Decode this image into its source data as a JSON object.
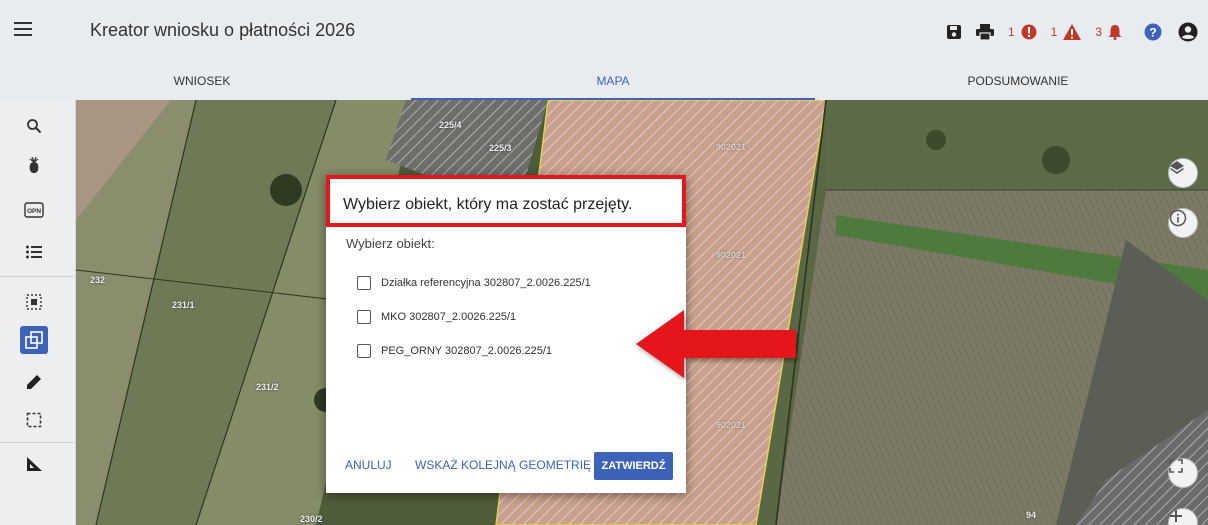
{
  "app": {
    "title": "Kreator wniosku o płatności 2026"
  },
  "toolbar": {
    "icons": [
      "save-icon",
      "print-icon",
      "error-icon",
      "warning-icon",
      "notification-bell-icon",
      "help-icon",
      "user-account-icon"
    ],
    "errors_count": "1",
    "warnings_count": "1",
    "notifications_count": "3",
    "alert_color": "#c0392b",
    "help_color": "#3d63b8"
  },
  "tabs": [
    {
      "label": "WNIOSEK",
      "active": false
    },
    {
      "label": "MAPA",
      "active": true
    },
    {
      "label": "PODSUMOWANIE",
      "active": false
    }
  ],
  "sidebar": {
    "items": [
      "search-icon",
      "crop-icon",
      "opn-icon",
      "list-icon",
      "select-area-icon",
      "copy-geometry-icon",
      "edit-pencil-icon",
      "dashed-rectangle-icon",
      "measure-ruler-icon"
    ],
    "opn_label": "OPN",
    "active_item": "copy-geometry-icon",
    "accent": "#3d63b8"
  },
  "map": {
    "parcel_labels": {
      "p225_4": "225/4",
      "p225_3": "225/3",
      "p232": "232",
      "p231_1": "231/1",
      "p231_2": "231/2",
      "p230_2": "230/2",
      "p94": "94",
      "hatch": "902021"
    },
    "highlight_color": "#d98a74",
    "boundary_color": "#e8d34a",
    "right_controls": [
      "layers-icon",
      "info-icon",
      "fullscreen-icon",
      "zoom-in-icon"
    ]
  },
  "dialog": {
    "title": "Wybierz obiekt, który ma zostać przejęty.",
    "subtitle": "Wybierz obiekt:",
    "options": [
      {
        "label": "Działka referencyjna 302807_2.0026.225/1",
        "checked": false
      },
      {
        "label": "MKO 302807_2.0026.225/1",
        "checked": false
      },
      {
        "label": "PEG_ORNY 302807_2.0026.225/1",
        "checked": false
      }
    ],
    "cancel": "ANULUJ",
    "next_geometry": "WSKAŻ KOLEJNĄ GEOMETRIĘ",
    "confirm": "ZATWIERDŹ",
    "title_highlight_color": "#e4181c"
  },
  "annotation": {
    "arrow_color": "#e4181c",
    "arrow_icon": "arrow-left-icon"
  }
}
